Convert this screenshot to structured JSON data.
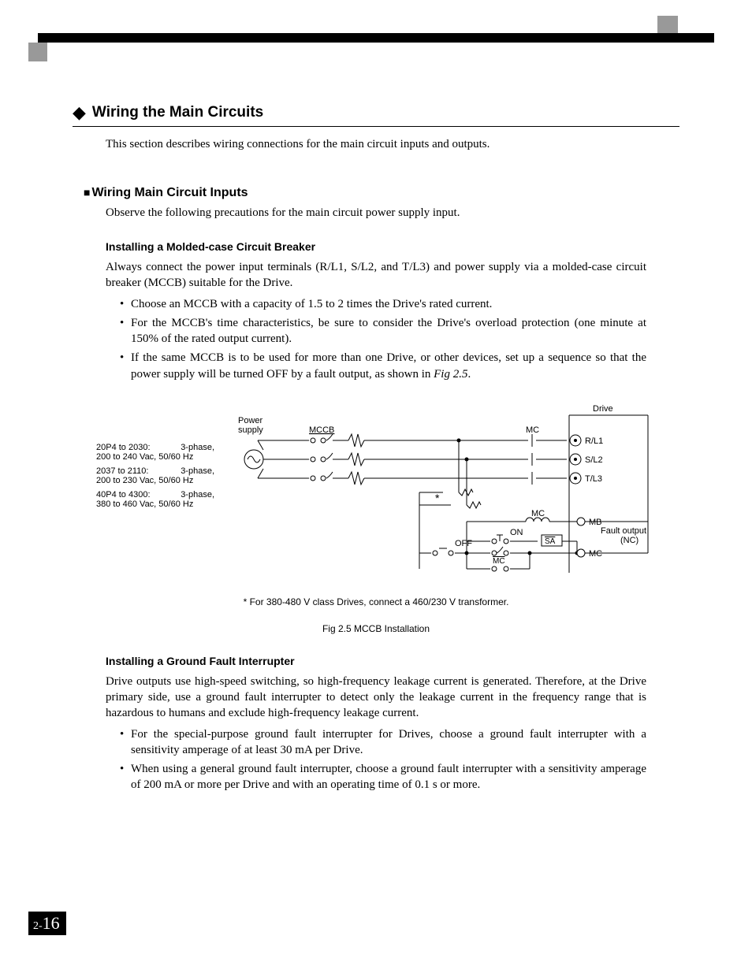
{
  "header": {
    "section_title": "Wiring the Main Circuits",
    "section_intro": "This section describes wiring connections for the main circuit inputs and outputs."
  },
  "sub_header": {
    "title": "Wiring Main Circuit Inputs",
    "intro": "Observe the following precautions for the main circuit power supply input."
  },
  "mccb": {
    "title": "Installing a Molded-case Circuit Breaker",
    "para": "Always connect the power input terminals (R/L1, S/L2, and T/L3) and power supply via a molded-case circuit breaker (MCCB) suitable for the Drive.",
    "bullets": [
      "Choose an MCCB with a capacity of 1.5 to 2 times the Drive's rated current.",
      "For the MCCB's time characteristics, be sure to consider the Drive's overload protection (one minute at 150% of the rated output current).",
      "If the same MCCB is to be used for more than one Drive, or other devices, set up a sequence so that the power supply will be turned OFF by a fault output, as shown in "
    ],
    "fig_ref": "Fig 2.5"
  },
  "figure": {
    "labels": {
      "power_supply": "Power supply",
      "mccb": "MCCB",
      "mc": "MC",
      "drive": "Drive",
      "r": "R/L1",
      "s": "S/L2",
      "t": "T/L3",
      "mb": "MB",
      "mc_term": "MC",
      "fault_output": "Fault output (NC)",
      "on": "ON",
      "off": "OFF",
      "sa": "SA",
      "mc2": "MC",
      "asterisk": "*"
    },
    "supply_specs": [
      {
        "range": "20P4 to 2030:",
        "desc": "3-phase, 200 to 240 Vac, 50/60 Hz"
      },
      {
        "range": "2037 to 2110:",
        "desc": "3-phase, 200 to 230 Vac, 50/60 Hz"
      },
      {
        "range": "40P4 to 4300:",
        "desc": "3-phase, 380 to 460 Vac, 50/60 Hz"
      }
    ],
    "note": "* For 380-480 V class Drives, connect a 460/230 V transformer.",
    "caption": "Fig 2.5  MCCB Installation"
  },
  "gfi": {
    "title": "Installing a Ground Fault Interrupter",
    "para": "Drive outputs use high-speed switching, so high-frequency leakage current is generated. Therefore, at the Drive primary side, use a ground fault interrupter to detect only the leakage current in the frequency range that is hazardous to humans and exclude high-frequency leakage current.",
    "bullets": [
      "For the special-purpose ground fault interrupter for Drives, choose a ground fault interrupter with a sensitivity amperage of at least 30 mA per Drive.",
      "When using a general ground fault interrupter, choose a ground fault interrupter with a sensitivity amperage of 200 mA or more per Drive and with an operating time of 0.1 s or more."
    ]
  },
  "page_number": {
    "chapter": "2-",
    "page": "16"
  },
  "period": "."
}
